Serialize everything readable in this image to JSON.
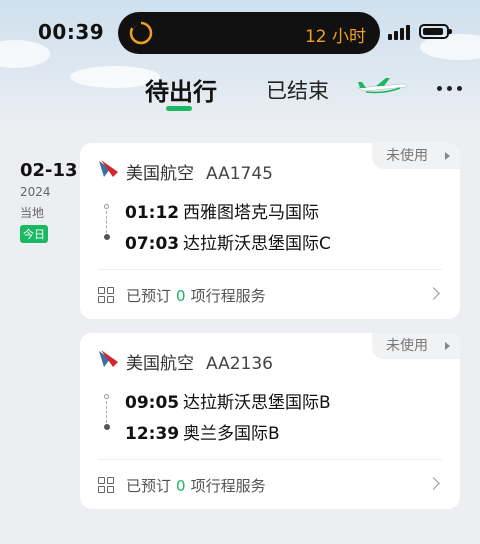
{
  "status_bar": {
    "time": "00:39",
    "island_text": "12 小时"
  },
  "tabs": {
    "active_label": "待出行",
    "inactive_label": "已结束"
  },
  "date_group": {
    "month_day": "02-13",
    "year": "2024",
    "timezone_label": "当地",
    "today_badge": "今日"
  },
  "trips": [
    {
      "status_tag": "未使用",
      "airline": "美国航空",
      "flight_no": "AA1745",
      "departure": {
        "time": "01:12",
        "airport": "西雅图塔克马国际"
      },
      "arrival": {
        "time": "07:03",
        "airport": "达拉斯沃思堡国际C"
      },
      "service": {
        "prefix": "已预订",
        "count": "0",
        "suffix": "项行程服务"
      }
    },
    {
      "status_tag": "未使用",
      "airline": "美国航空",
      "flight_no": "AA2136",
      "departure": {
        "time": "09:05",
        "airport": "达拉斯沃思堡国际B"
      },
      "arrival": {
        "time": "12:39",
        "airport": "奥兰多国际B"
      },
      "service": {
        "prefix": "已预订",
        "count": "0",
        "suffix": "项行程服务"
      }
    }
  ],
  "colors": {
    "accent": "#1bb863",
    "timer": "#f0a020"
  },
  "icons": [
    "timer-icon",
    "signal-icon",
    "battery-icon",
    "airplane-icon",
    "more-icon",
    "airline-logo-icon",
    "grid-icon",
    "chevron-right-icon"
  ]
}
